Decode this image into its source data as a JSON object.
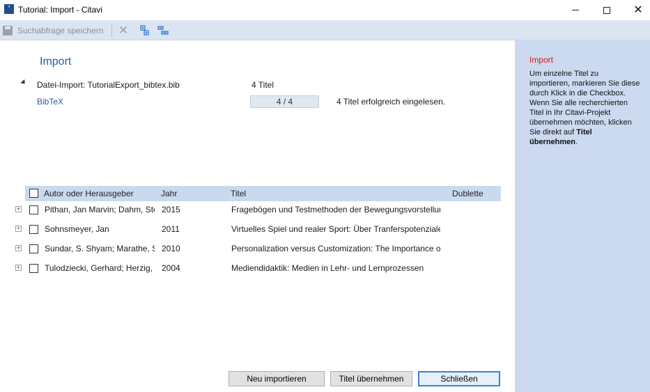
{
  "window": {
    "title": "Tutorial: Import - Citavi",
    "app_icon_glyph": "’"
  },
  "toolbar": {
    "save_label": "Suchabfrage speichern"
  },
  "import": {
    "heading": "Import",
    "file_import_label": "Datei-Import: TutorialExport_bibtex.bib",
    "file_import_count": "4 Titel",
    "format_label": "BibTeX",
    "progress_text": "4 / 4",
    "progress_fraction": 1.0,
    "status_text": "4 Titel erfolgreich eingelesen."
  },
  "table": {
    "headers": {
      "author": "Autor oder Herausgeber",
      "year": "Jahr",
      "title": "Titel",
      "duplicate": "Dublette"
    },
    "rows": [
      {
        "author": "Pithan, Jan Marvin; Dahm, Ste",
        "year": "2015",
        "title": "Fragebögen und Testmethoden der Bewegungsvorstellun",
        "duplicate": ""
      },
      {
        "author": "Sohnsmeyer, Jan",
        "year": "2011",
        "title": "Virtuelles Spiel und realer Sport: Über Tranferspotenziale",
        "duplicate": ""
      },
      {
        "author": "Sundar, S. Shyam; Marathe, S",
        "year": "2010",
        "title": "Personalization versus Customization: The Importance of",
        "duplicate": ""
      },
      {
        "author": "Tulodziecki, Gerhard; Herzig,",
        "year": "2004",
        "title": "Mediendidaktik: Medien in Lehr- und Lernprozessen",
        "duplicate": ""
      }
    ]
  },
  "buttons": {
    "reimport": "Neu importieren",
    "take_titles": "Titel übernehmen",
    "close": "Schließen"
  },
  "help": {
    "title": "Import",
    "text_before_bold": "Um einzelne Titel zu importieren, markieren Sie diese durch Klick in die Checkbox. Wenn Sie alle recherchierten Titel in Ihr Citavi-Projekt übernehmen möchten, klicken Sie direkt auf ",
    "text_bold": "Titel übernehmen",
    "text_after_bold": "."
  },
  "colors": {
    "accent_blue": "#2a5aa0",
    "help_title_red": "#d11919",
    "help_panel_bg": "#cbdaf0",
    "toolbar_bg": "#dbe5f2",
    "table_header_bg": "#c9d9ee"
  }
}
